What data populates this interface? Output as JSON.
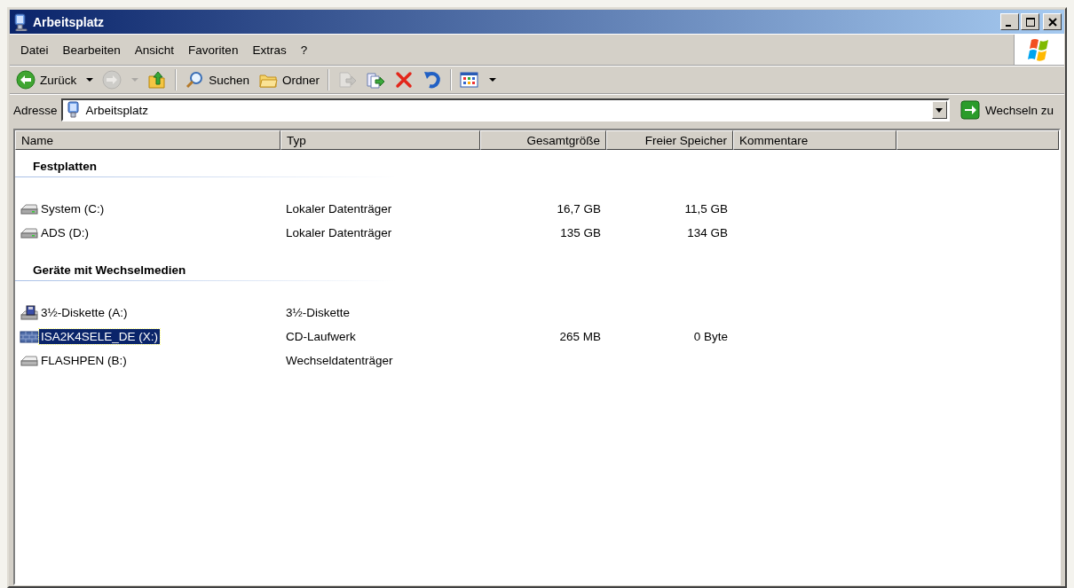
{
  "window": {
    "title": "Arbeitsplatz"
  },
  "menu": [
    "Datei",
    "Bearbeiten",
    "Ansicht",
    "Favoriten",
    "Extras",
    "?"
  ],
  "toolbar": {
    "groups": [
      [
        {
          "kind": "back",
          "label": "Zurück",
          "dropdown": true,
          "disabled": false
        },
        {
          "kind": "forward",
          "dropdown": true,
          "disabled": true
        },
        {
          "kind": "up",
          "dropdown": false,
          "disabled": false
        }
      ],
      [
        {
          "kind": "search",
          "label": "Suchen",
          "dropdown": false,
          "disabled": false
        },
        {
          "kind": "folders",
          "label": "Ordner",
          "dropdown": false,
          "disabled": false
        }
      ],
      [
        {
          "kind": "move",
          "dropdown": false,
          "disabled": true
        },
        {
          "kind": "copy",
          "dropdown": false,
          "disabled": false
        },
        {
          "kind": "delete",
          "dropdown": false,
          "disabled": false
        },
        {
          "kind": "undo",
          "dropdown": false,
          "disabled": false
        }
      ],
      [
        {
          "kind": "views",
          "dropdown": true,
          "disabled": false
        }
      ]
    ]
  },
  "address": {
    "label": "Adresse",
    "value": "Arbeitsplatz",
    "go_label": "Wechseln zu"
  },
  "list": {
    "columns": [
      "Name",
      "Typ",
      "Gesamtgröße",
      "Freier Speicher",
      "Kommentare"
    ],
    "groups": [
      {
        "title": "Festplatten",
        "rows": [
          {
            "kind": "harddisk",
            "name": "System (C:)",
            "type": "Lokaler Datenträger",
            "total": "16,7 GB",
            "free": "11,5 GB",
            "selected": false
          },
          {
            "kind": "harddisk",
            "name": "ADS (D:)",
            "type": "Lokaler Datenträger",
            "total": "135 GB",
            "free": "134 GB",
            "selected": false
          }
        ]
      },
      {
        "title": "Geräte mit Wechselmedien",
        "rows": [
          {
            "kind": "floppy",
            "name": "3½-Diskette (A:)",
            "type": "3½-Diskette",
            "selected": false
          },
          {
            "kind": "cdrom",
            "name": "ISA2K4SELE_DE (X:)",
            "type": "CD-Laufwerk",
            "total": "265 MB",
            "free": "0 Byte",
            "selected": true
          },
          {
            "kind": "removable",
            "name": "FLASHPEN (B:)",
            "type": "Wechseldatenträger",
            "selected": false
          }
        ]
      }
    ]
  }
}
